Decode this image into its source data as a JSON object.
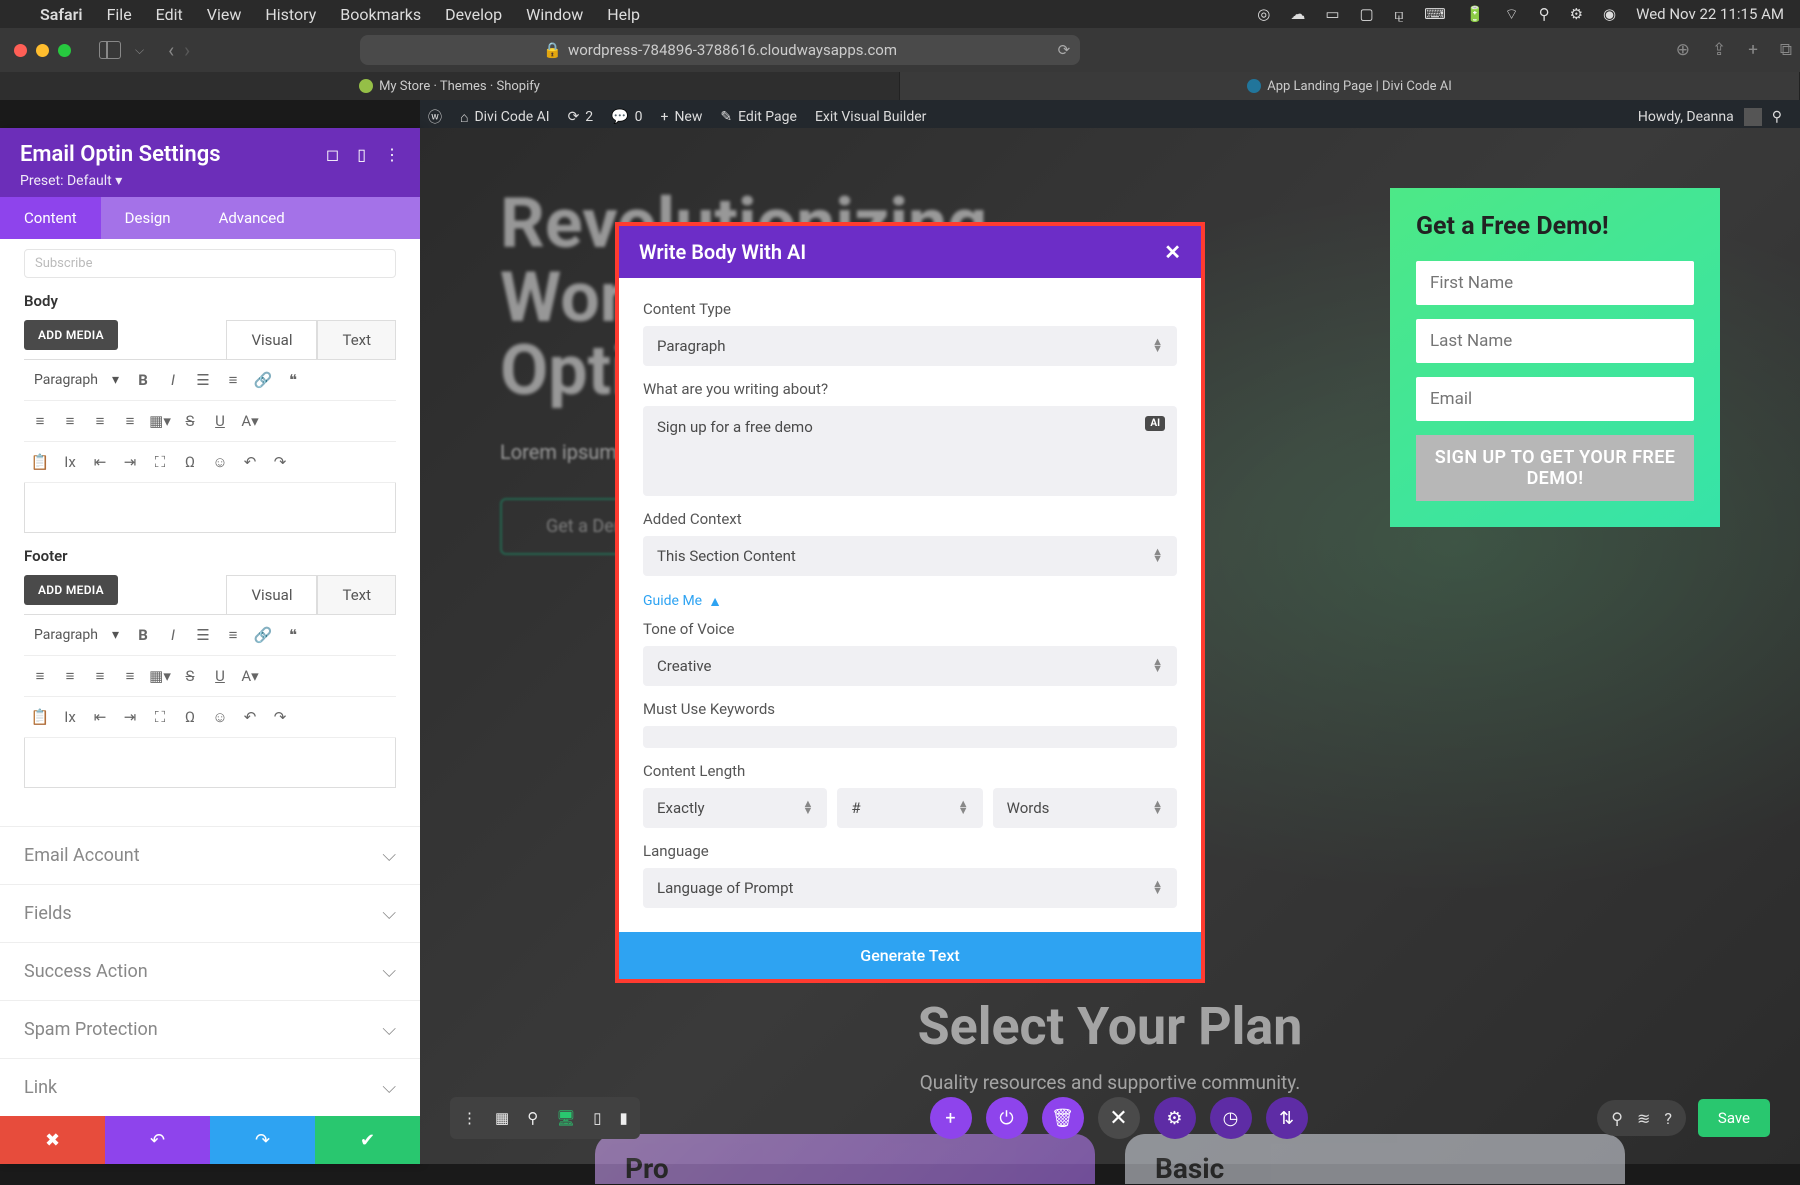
{
  "menubar": {
    "app": "Safari",
    "items": [
      "File",
      "Edit",
      "View",
      "History",
      "Bookmarks",
      "Develop",
      "Window",
      "Help"
    ],
    "datetime": "Wed Nov 22  11:15 AM"
  },
  "safari": {
    "url": "wordpress-784896-3788616.cloudwaysapps.com",
    "tabs": [
      {
        "title": "My Store · Themes · Shopify"
      },
      {
        "title": "App Landing Page | Divi Code AI"
      }
    ]
  },
  "wp_bar": {
    "site": "Divi Code AI",
    "revisions": "2",
    "comments": "0",
    "new": "New",
    "edit": "Edit Page",
    "exit": "Exit Visual Builder",
    "howdy": "Howdy, Deanna"
  },
  "panel": {
    "title": "Email Optin Settings",
    "preset": "Preset: Default",
    "tabs": [
      "Content",
      "Design",
      "Advanced"
    ],
    "subscribe_placeholder": "Subscribe",
    "body_label": "Body",
    "footer_label": "Footer",
    "add_media": "ADD MEDIA",
    "editor_tabs": [
      "Visual",
      "Text"
    ],
    "toolbar_format": "Paragraph",
    "accordions": [
      "Email Account",
      "Fields",
      "Success Action",
      "Spam Protection",
      "Link"
    ]
  },
  "canvas": {
    "hero_line1": "Revolutionizing",
    "hero_line2": "Work With Many",
    "hero_line3": "Options",
    "hero_desc_partial": "Lorem ipsum dolor sit amet, consectetur adipiscing elit. Sed dictum eros.",
    "cta": "Get a Demo",
    "optin": {
      "title": "Get a Free Demo!",
      "first": "First Name",
      "last": "Last Name",
      "email": "Email",
      "button": "SIGN UP TO GET YOUR FREE DEMO!"
    },
    "plans": {
      "title": "Select Your Plan",
      "desc": "Quality resources and supportive community.",
      "pro": "Pro",
      "basic": "Basic"
    }
  },
  "ai_modal": {
    "title": "Write Body With AI",
    "content_type_label": "Content Type",
    "content_type_value": "Paragraph",
    "about_label": "What are you writing about?",
    "about_value": "Sign up for a free demo",
    "ai_badge": "AI",
    "context_label": "Added Context",
    "context_value": "This Section Content",
    "guide_me": "Guide Me",
    "tone_label": "Tone of Voice",
    "tone_value": "Creative",
    "keywords_label": "Must Use Keywords",
    "length_label": "Content Length",
    "length_mode": "Exactly",
    "length_count_placeholder": "#",
    "length_unit": "Words",
    "language_label": "Language",
    "language_value": "Language of Prompt",
    "generate": "Generate Text"
  },
  "dock": {
    "save": "Save"
  }
}
